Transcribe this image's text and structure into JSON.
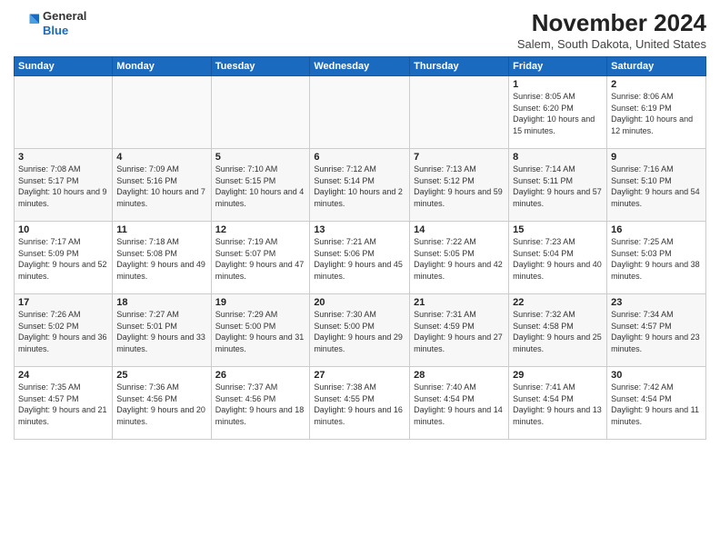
{
  "logo": {
    "general": "General",
    "blue": "Blue"
  },
  "title": "November 2024",
  "subtitle": "Salem, South Dakota, United States",
  "days_of_week": [
    "Sunday",
    "Monday",
    "Tuesday",
    "Wednesday",
    "Thursday",
    "Friday",
    "Saturday"
  ],
  "weeks": [
    [
      {
        "day": "",
        "info": ""
      },
      {
        "day": "",
        "info": ""
      },
      {
        "day": "",
        "info": ""
      },
      {
        "day": "",
        "info": ""
      },
      {
        "day": "",
        "info": ""
      },
      {
        "day": "1",
        "info": "Sunrise: 8:05 AM\nSunset: 6:20 PM\nDaylight: 10 hours and 15 minutes."
      },
      {
        "day": "2",
        "info": "Sunrise: 8:06 AM\nSunset: 6:19 PM\nDaylight: 10 hours and 12 minutes."
      }
    ],
    [
      {
        "day": "3",
        "info": "Sunrise: 7:08 AM\nSunset: 5:17 PM\nDaylight: 10 hours and 9 minutes."
      },
      {
        "day": "4",
        "info": "Sunrise: 7:09 AM\nSunset: 5:16 PM\nDaylight: 10 hours and 7 minutes."
      },
      {
        "day": "5",
        "info": "Sunrise: 7:10 AM\nSunset: 5:15 PM\nDaylight: 10 hours and 4 minutes."
      },
      {
        "day": "6",
        "info": "Sunrise: 7:12 AM\nSunset: 5:14 PM\nDaylight: 10 hours and 2 minutes."
      },
      {
        "day": "7",
        "info": "Sunrise: 7:13 AM\nSunset: 5:12 PM\nDaylight: 9 hours and 59 minutes."
      },
      {
        "day": "8",
        "info": "Sunrise: 7:14 AM\nSunset: 5:11 PM\nDaylight: 9 hours and 57 minutes."
      },
      {
        "day": "9",
        "info": "Sunrise: 7:16 AM\nSunset: 5:10 PM\nDaylight: 9 hours and 54 minutes."
      }
    ],
    [
      {
        "day": "10",
        "info": "Sunrise: 7:17 AM\nSunset: 5:09 PM\nDaylight: 9 hours and 52 minutes."
      },
      {
        "day": "11",
        "info": "Sunrise: 7:18 AM\nSunset: 5:08 PM\nDaylight: 9 hours and 49 minutes."
      },
      {
        "day": "12",
        "info": "Sunrise: 7:19 AM\nSunset: 5:07 PM\nDaylight: 9 hours and 47 minutes."
      },
      {
        "day": "13",
        "info": "Sunrise: 7:21 AM\nSunset: 5:06 PM\nDaylight: 9 hours and 45 minutes."
      },
      {
        "day": "14",
        "info": "Sunrise: 7:22 AM\nSunset: 5:05 PM\nDaylight: 9 hours and 42 minutes."
      },
      {
        "day": "15",
        "info": "Sunrise: 7:23 AM\nSunset: 5:04 PM\nDaylight: 9 hours and 40 minutes."
      },
      {
        "day": "16",
        "info": "Sunrise: 7:25 AM\nSunset: 5:03 PM\nDaylight: 9 hours and 38 minutes."
      }
    ],
    [
      {
        "day": "17",
        "info": "Sunrise: 7:26 AM\nSunset: 5:02 PM\nDaylight: 9 hours and 36 minutes."
      },
      {
        "day": "18",
        "info": "Sunrise: 7:27 AM\nSunset: 5:01 PM\nDaylight: 9 hours and 33 minutes."
      },
      {
        "day": "19",
        "info": "Sunrise: 7:29 AM\nSunset: 5:00 PM\nDaylight: 9 hours and 31 minutes."
      },
      {
        "day": "20",
        "info": "Sunrise: 7:30 AM\nSunset: 5:00 PM\nDaylight: 9 hours and 29 minutes."
      },
      {
        "day": "21",
        "info": "Sunrise: 7:31 AM\nSunset: 4:59 PM\nDaylight: 9 hours and 27 minutes."
      },
      {
        "day": "22",
        "info": "Sunrise: 7:32 AM\nSunset: 4:58 PM\nDaylight: 9 hours and 25 minutes."
      },
      {
        "day": "23",
        "info": "Sunrise: 7:34 AM\nSunset: 4:57 PM\nDaylight: 9 hours and 23 minutes."
      }
    ],
    [
      {
        "day": "24",
        "info": "Sunrise: 7:35 AM\nSunset: 4:57 PM\nDaylight: 9 hours and 21 minutes."
      },
      {
        "day": "25",
        "info": "Sunrise: 7:36 AM\nSunset: 4:56 PM\nDaylight: 9 hours and 20 minutes."
      },
      {
        "day": "26",
        "info": "Sunrise: 7:37 AM\nSunset: 4:56 PM\nDaylight: 9 hours and 18 minutes."
      },
      {
        "day": "27",
        "info": "Sunrise: 7:38 AM\nSunset: 4:55 PM\nDaylight: 9 hours and 16 minutes."
      },
      {
        "day": "28",
        "info": "Sunrise: 7:40 AM\nSunset: 4:54 PM\nDaylight: 9 hours and 14 minutes."
      },
      {
        "day": "29",
        "info": "Sunrise: 7:41 AM\nSunset: 4:54 PM\nDaylight: 9 hours and 13 minutes."
      },
      {
        "day": "30",
        "info": "Sunrise: 7:42 AM\nSunset: 4:54 PM\nDaylight: 9 hours and 11 minutes."
      }
    ]
  ]
}
